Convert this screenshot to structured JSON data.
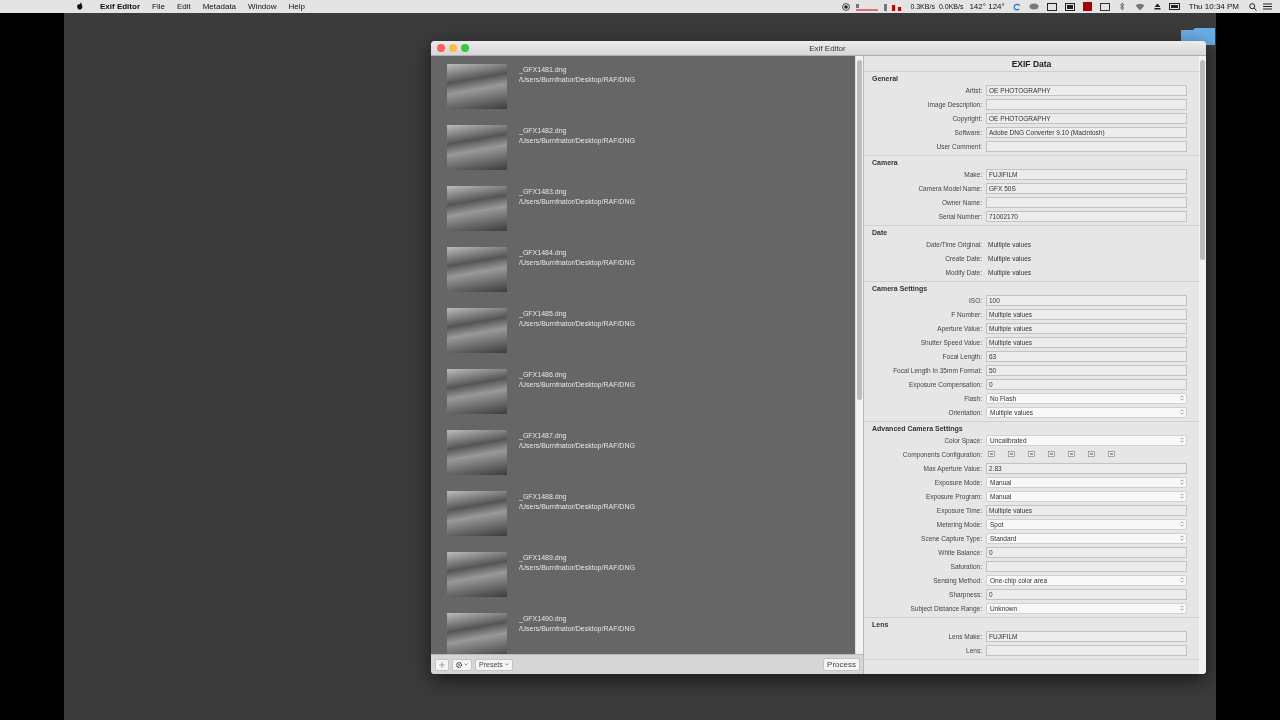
{
  "menu_bar": {
    "app": "Exif Editor",
    "menus": [
      "File",
      "Edit",
      "Metadata",
      "Window",
      "Help"
    ],
    "net_up": "0.3KB/s",
    "net_down": "0.0KB/s",
    "temps": "142° 124°",
    "clock": "Thu 10:34 PM"
  },
  "window": {
    "title": "Exif Editor"
  },
  "files": [
    {
      "name": "_GFX1481.dng",
      "path": "/Users/Burnfnator/Desktop/RAF/DNG"
    },
    {
      "name": "_GFX1482.dng",
      "path": "/Users/Burnfnator/Desktop/RAF/DNG"
    },
    {
      "name": "_GFX1483.dng",
      "path": "/Users/Burnfnator/Desktop/RAF/DNG"
    },
    {
      "name": "_GFX1484.dng",
      "path": "/Users/Burnfnator/Desktop/RAF/DNG"
    },
    {
      "name": "_GFX1485.dng",
      "path": "/Users/Burnfnator/Desktop/RAF/DNG"
    },
    {
      "name": "_GFX1486.dng",
      "path": "/Users/Burnfnator/Desktop/RAF/DNG"
    },
    {
      "name": "_GFX1487.dng",
      "path": "/Users/Burnfnator/Desktop/RAF/DNG"
    },
    {
      "name": "_GFX1488.dng",
      "path": "/Users/Burnfnator/Desktop/RAF/DNG"
    },
    {
      "name": "_GFX1489.dng",
      "path": "/Users/Burnfnator/Desktop/RAF/DNG"
    },
    {
      "name": "_GFX1490.dng",
      "path": "/Users/Burnfnator/Desktop/RAF/DNG"
    }
  ],
  "toolbar": {
    "presets": "Presets",
    "process": "Process"
  },
  "exif": {
    "title": "EXIF Data",
    "sections": [
      {
        "title": "General",
        "fields": [
          {
            "label": "Artist:",
            "kind": "text",
            "value": "OE PHOTOGRAPHY"
          },
          {
            "label": "Image Description:",
            "kind": "text"
          },
          {
            "label": "Copyright:",
            "kind": "text",
            "value": "OE PHOTOGRAPHY"
          },
          {
            "label": "Software:",
            "kind": "text",
            "value": "Adobe DNG Converter 9.10 (Macintosh)"
          },
          {
            "label": "User Comment:",
            "kind": "text"
          }
        ]
      },
      {
        "title": "Camera",
        "fields": [
          {
            "label": "Make:",
            "kind": "text",
            "value": "FUJIFILM"
          },
          {
            "label": "Camera Model Name:",
            "kind": "text",
            "value": "GFX 50S"
          },
          {
            "label": "Owner Name:",
            "kind": "text"
          },
          {
            "label": "Serial Number:",
            "kind": "text",
            "value": "71002170"
          }
        ]
      },
      {
        "title": "Date",
        "fields": [
          {
            "label": "Date/Time Original:",
            "kind": "static",
            "value": "Multiple values"
          },
          {
            "label": "Create Date:",
            "kind": "static",
            "value": "Multiple values"
          },
          {
            "label": "Modify Date:",
            "kind": "static",
            "value": "Multiple values"
          }
        ]
      },
      {
        "title": "Camera Settings",
        "fields": [
          {
            "label": "ISO:",
            "kind": "text",
            "value": "100"
          },
          {
            "label": "F Number:",
            "kind": "text",
            "value": "Multiple values"
          },
          {
            "label": "Aperture Value:",
            "kind": "text",
            "value": "Multiple values"
          },
          {
            "label": "Shutter Speed Value:",
            "kind": "text",
            "value": "Multiple values"
          },
          {
            "label": "Focal Length:",
            "kind": "text",
            "value": "63"
          },
          {
            "label": "Focal Length In 35mm Format:",
            "kind": "text",
            "value": "50"
          },
          {
            "label": "Exposure Compensation:",
            "kind": "text",
            "value": "0"
          },
          {
            "label": "Flash:",
            "kind": "popup",
            "value": "No Flash"
          },
          {
            "label": "Orientation:",
            "kind": "popup",
            "value": "Multiple values"
          }
        ]
      },
      {
        "title": "Advanced Camera Settings",
        "fields": [
          {
            "label": "Color Space:",
            "kind": "popup",
            "value": "Uncalibrated"
          },
          {
            "label": "Components Configuration:",
            "kind": "components"
          },
          {
            "label": "Max Aperture Value:",
            "kind": "text",
            "value": "2.83"
          },
          {
            "label": "Exposure Mode:",
            "kind": "popup",
            "value": "Manual"
          },
          {
            "label": "Exposure Program:",
            "kind": "popup",
            "value": "Manual"
          },
          {
            "label": "Exposure Time:",
            "kind": "text",
            "value": "Multiple values"
          },
          {
            "label": "Metering Mode:",
            "kind": "popup",
            "value": "Spot"
          },
          {
            "label": "Scene Capture Type:",
            "kind": "popup",
            "value": "Standard"
          },
          {
            "label": "White Balance:",
            "kind": "text",
            "value": "0"
          },
          {
            "label": "Saturation:",
            "kind": "text"
          },
          {
            "label": "Sensing Method:",
            "kind": "popup",
            "value": "One-chip color area"
          },
          {
            "label": "Sharpness:",
            "kind": "text",
            "value": "0"
          },
          {
            "label": "Subject Distance Range:",
            "kind": "popup",
            "value": "Unknown"
          }
        ]
      },
      {
        "title": "Lens",
        "fields": [
          {
            "label": "Lens Make:",
            "kind": "text",
            "value": "FUJIFILM"
          },
          {
            "label": "Lens:",
            "kind": "text"
          }
        ]
      }
    ]
  }
}
